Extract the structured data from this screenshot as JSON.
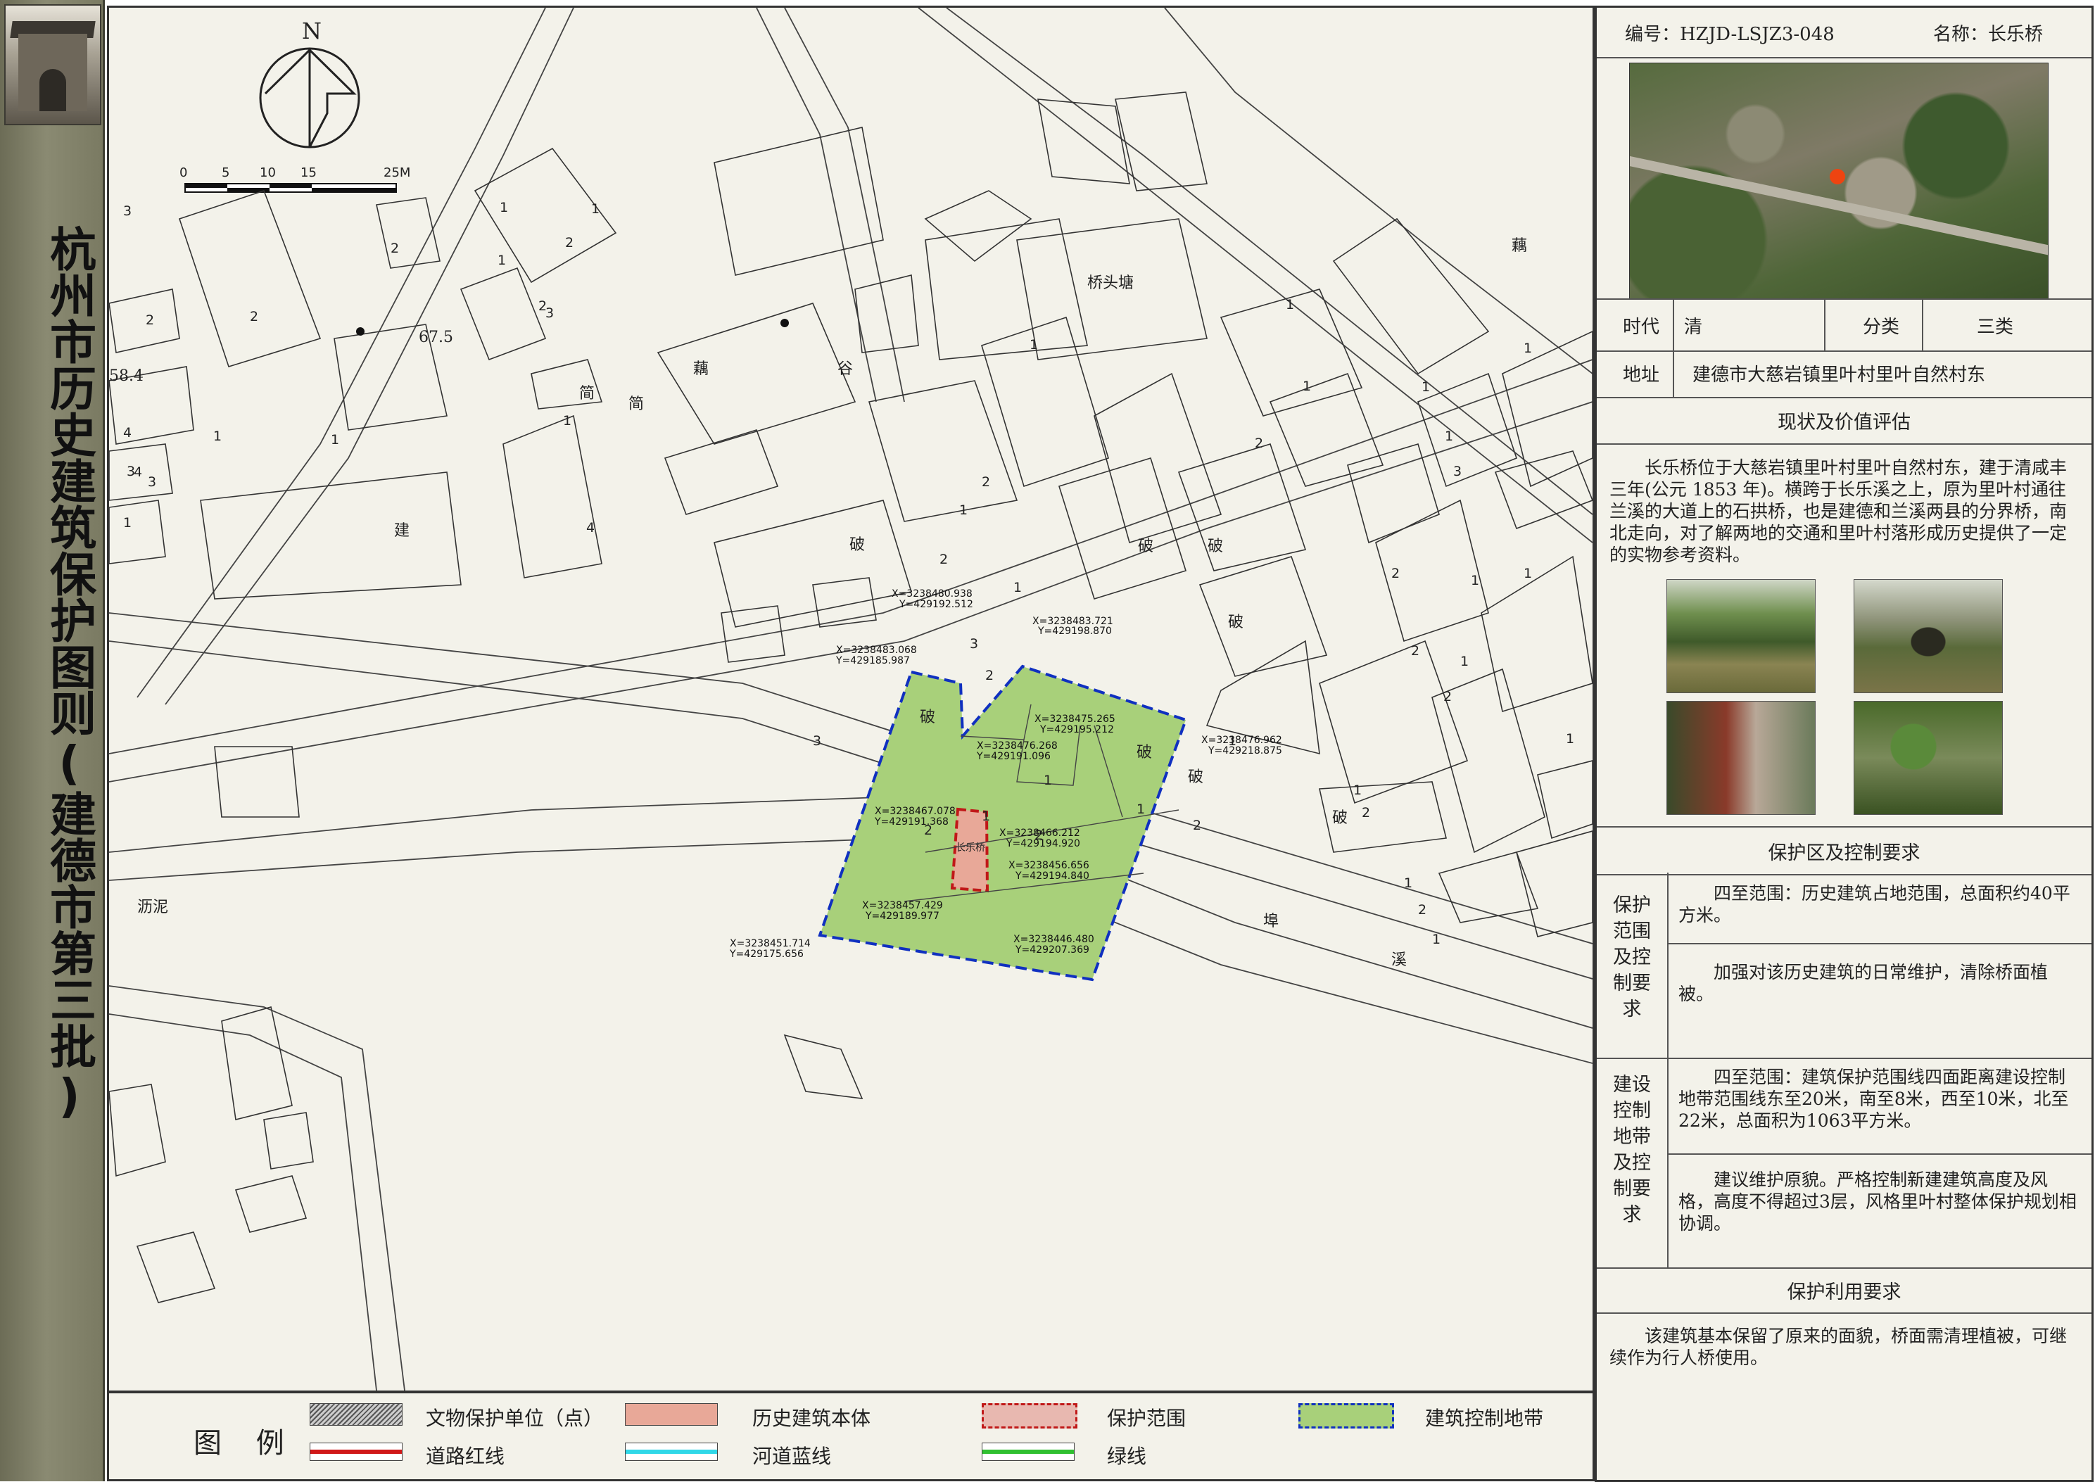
{
  "banner": {
    "title": "杭州市历史建筑保护图则(建德市第三批)"
  },
  "map": {
    "north_label": "N",
    "scale_ticks": [
      "0",
      "5",
      "10",
      "15",
      "25M"
    ],
    "place_labels": [
      "桥头塘",
      "藕",
      "谷",
      "建",
      "简",
      "简",
      "破",
      "破",
      "破",
      "破",
      "破",
      "破",
      "破",
      "破",
      "沥泥",
      "埠",
      "溪",
      "藕",
      "67.5",
      "58.4"
    ],
    "building_numbers": [
      "3",
      "2",
      "1",
      "2",
      "3",
      "2",
      "1",
      "4",
      "1",
      "4",
      "3",
      "1",
      "2",
      "4",
      "3",
      "1",
      "1",
      "2",
      "1",
      "1",
      "2",
      "1",
      "1",
      "3",
      "2",
      "3",
      "1",
      "2",
      "2",
      "2",
      "1",
      "1",
      "2",
      "1",
      "2",
      "2",
      "1",
      "1",
      "1",
      "2",
      "3",
      "1",
      "1",
      "2",
      "2",
      "1",
      "1",
      "1",
      "1",
      "1",
      "1",
      "1",
      "2"
    ],
    "structure_label": "长乐桥",
    "coords": [
      {
        "x": "X=3238480.938",
        "y": "Y=429192.512"
      },
      {
        "x": "X=3238483.721",
        "y": "Y=429198.870"
      },
      {
        "x": "X=3238483.068",
        "y": "Y=429185.987"
      },
      {
        "x": "X=3238475.265",
        "y": "Y=429195.212"
      },
      {
        "x": "X=3238476.268",
        "y": "Y=429191.096"
      },
      {
        "x": "X=3238476.962",
        "y": "Y=429218.875"
      },
      {
        "x": "X=3238467.078",
        "y": "Y=429191.368"
      },
      {
        "x": "X=3238466.212",
        "y": "Y=429194.920"
      },
      {
        "x": "X=3238456.656",
        "y": "Y=429194.840"
      },
      {
        "x": "X=3238457.429",
        "y": "Y=429189.977"
      },
      {
        "x": "X=3238451.714",
        "y": "Y=429175.656"
      },
      {
        "x": "X=3238446.480",
        "y": "Y=429207.369"
      }
    ]
  },
  "legend": {
    "title": "图 例",
    "items": [
      {
        "label": "文物保护单位（点）",
        "style": "hatch"
      },
      {
        "label": "历史建筑本体",
        "style": "fill",
        "color": "#e8a898"
      },
      {
        "label": "保护范围",
        "style": "dashed",
        "color": "#e8b8b0",
        "stroke": "#c01818"
      },
      {
        "label": "建筑控制地带",
        "style": "dashed",
        "color": "#a8d07a",
        "stroke": "#1030c0"
      },
      {
        "label": "道路红线",
        "style": "line",
        "color": "#d01818"
      },
      {
        "label": "河道蓝线",
        "style": "line",
        "color": "#30d8e8"
      },
      {
        "label": "绿线",
        "style": "line",
        "color": "#30c030"
      }
    ]
  },
  "panel": {
    "code_label": "编号：HZJD-LSJZ3-048",
    "name_label": "名称：长乐桥",
    "era_label": "时代",
    "era_value": "清",
    "category_label": "分类",
    "category_value": "三类",
    "address_label": "地址",
    "address_value": "建德市大慈岩镇里叶村里叶自然村东",
    "status_header": "现状及价值评估",
    "status_text": "长乐桥位于大慈岩镇里叶村里叶自然村东，建于清咸丰三年(公元 1853 年)。横跨于长乐溪之上，原为里叶村通往兰溪的大道上的石拱桥，也是建德和兰溪两县的分界桥，南北走向，对了解两地的交通和里叶村落形成历史提供了一定的实物参考资料。",
    "protect_header": "保护区及控制要求",
    "protect_label": "保护范围及控制要求",
    "protect_text1": "四至范围：历史建筑占地范围，总面积约40平方米。",
    "protect_text2": "加强对该历史建筑的日常维护，清除桥面植被。",
    "control_label": "建设控制地带及控制要求",
    "control_text1": "四至范围：建筑保护范围线四面距离建设控制地带范围线东至20米，南至8米，西至10米，北至22米，总面积为1063平方米。",
    "control_text2": "建议维护原貌。严格控制新建建筑高度及风格，高度不得超过3层，风格里叶村整体保护规划相协调。",
    "use_header": "保护利用要求",
    "use_text": "该建筑基本保留了原来的面貌，桥面需清理植被，可继续作为行人桥使用。"
  },
  "colors": {
    "control_zone": "#a8d07a",
    "building_body": "#e8a898",
    "map_bg": "#f3f2ea",
    "marker": "#ee4411"
  }
}
